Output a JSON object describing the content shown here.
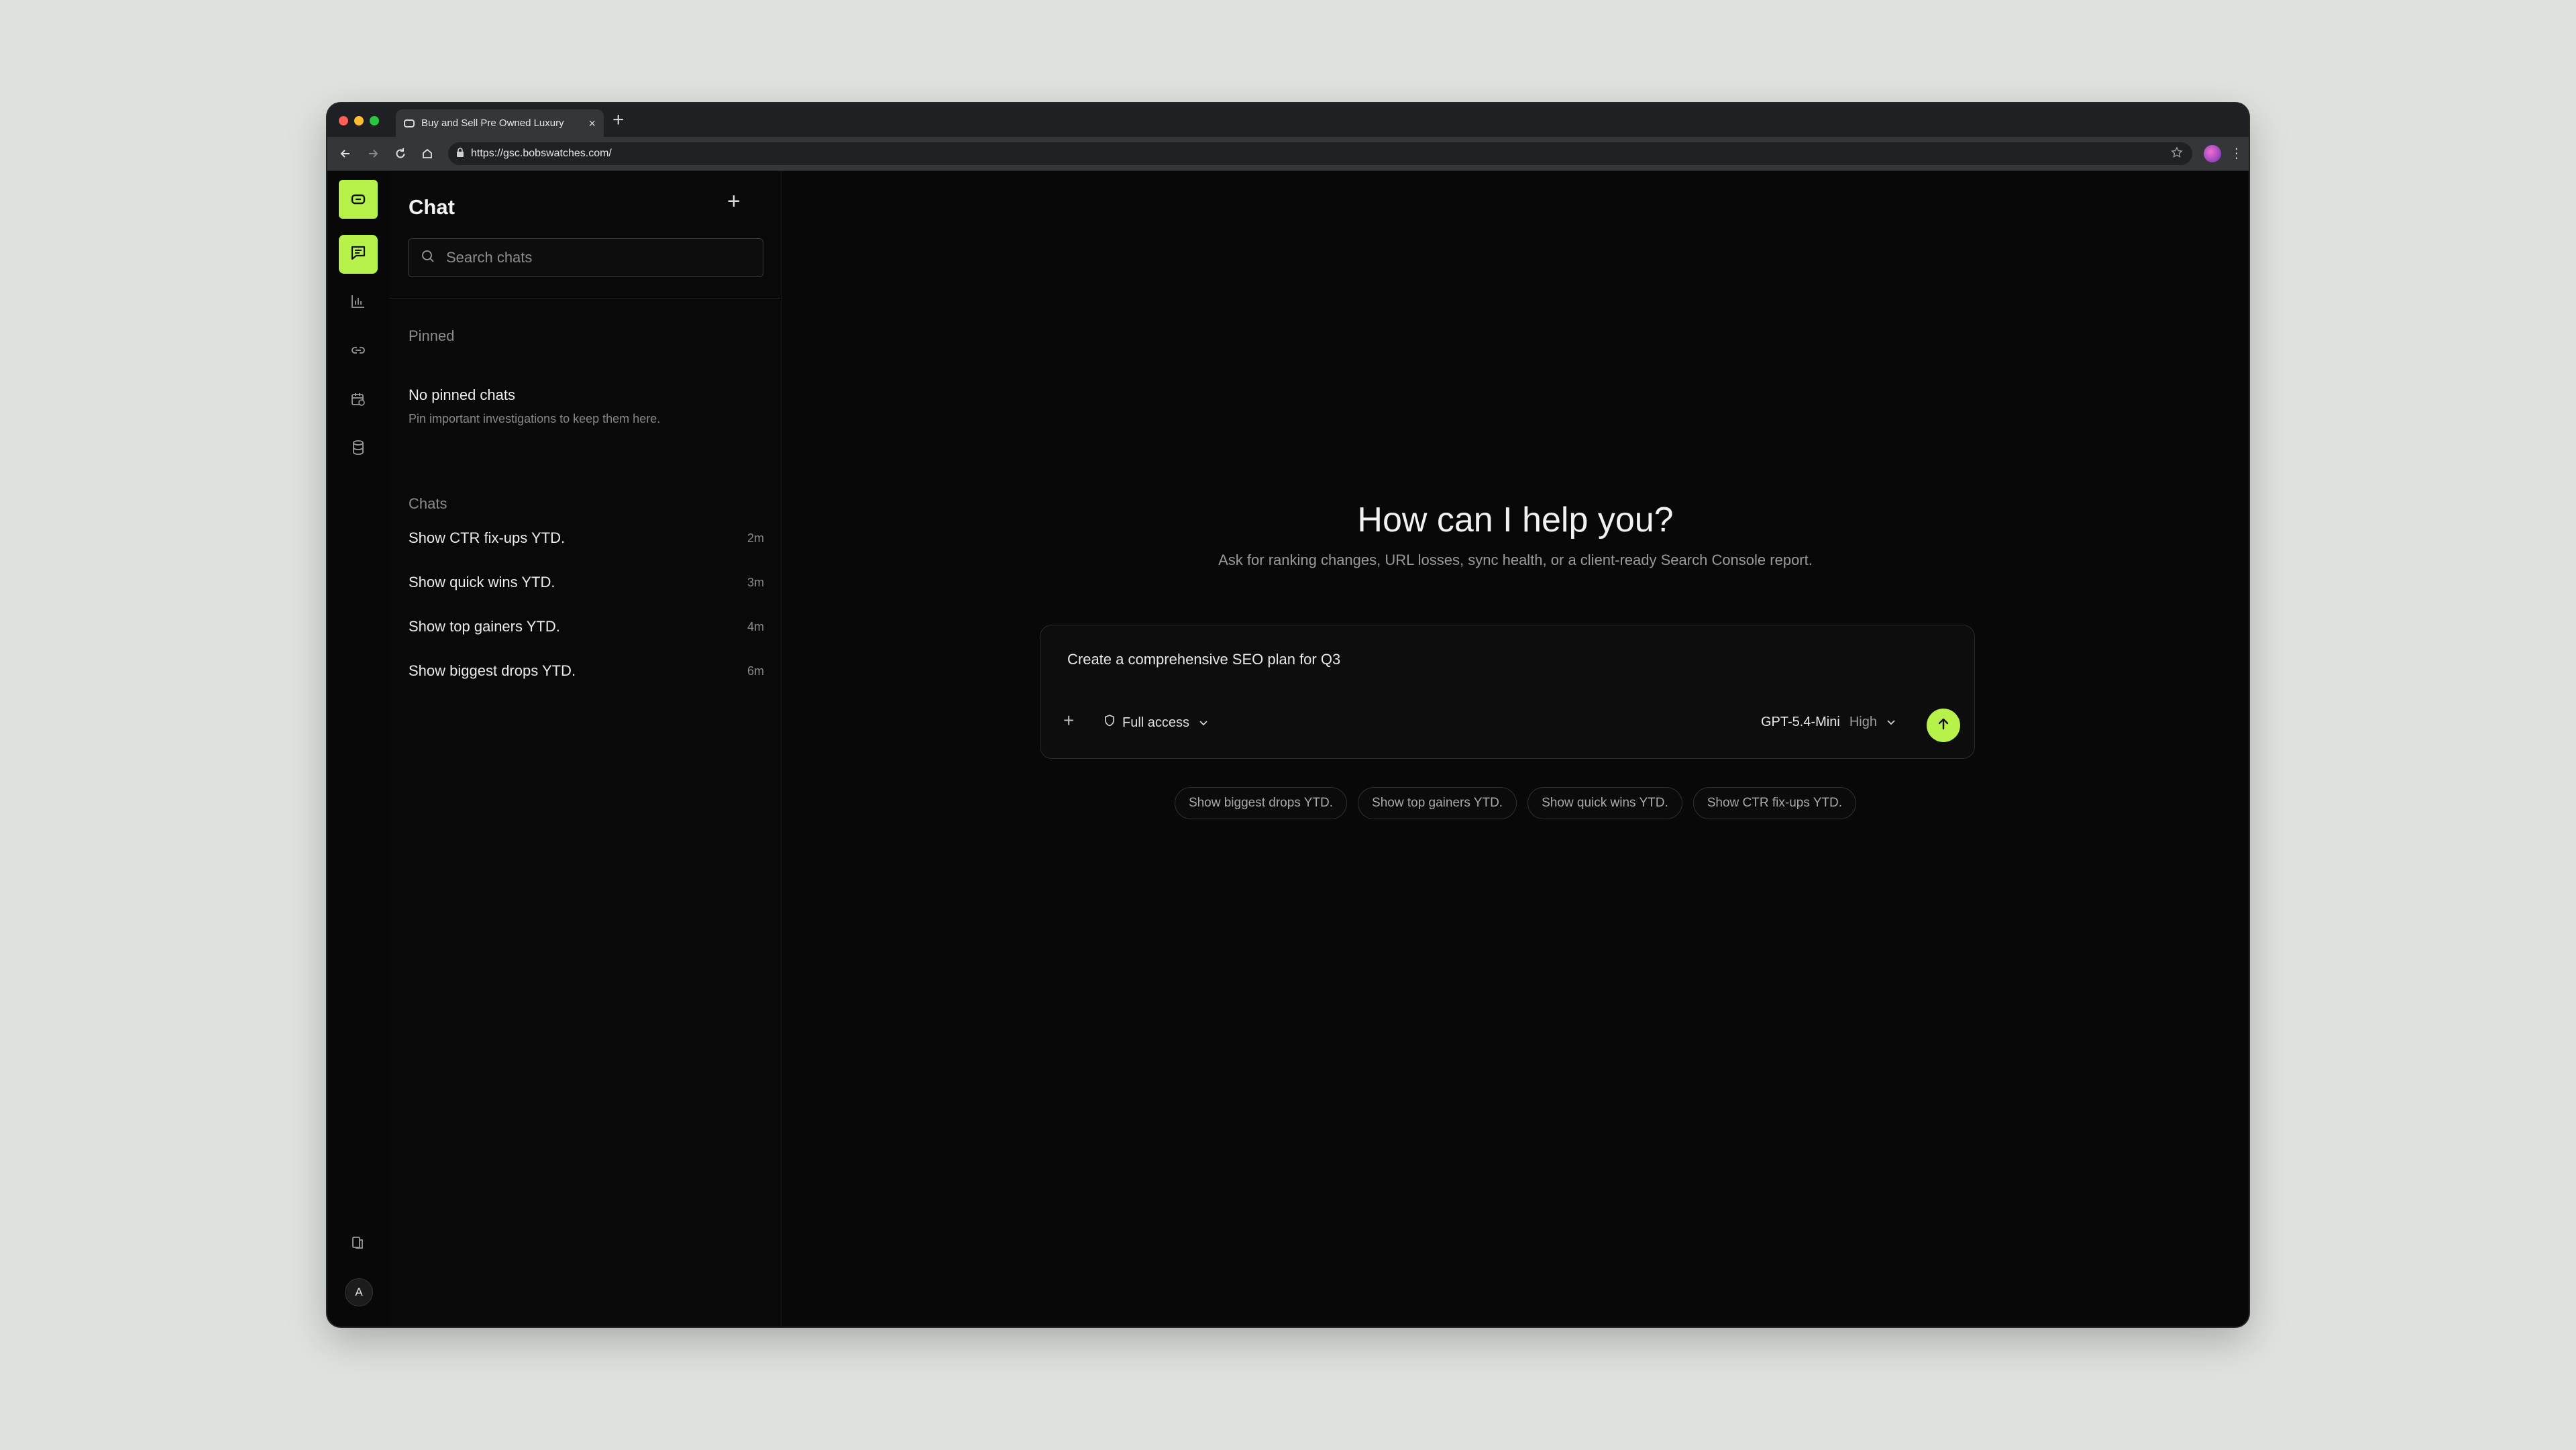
{
  "browser": {
    "tab_title": "Buy and Sell Pre Owned Luxury",
    "url": "https://gsc.bobswatches.com/"
  },
  "rail": {
    "items": [
      {
        "name": "chat-icon",
        "active": true
      },
      {
        "name": "chart-icon",
        "active": false
      },
      {
        "name": "link-icon",
        "active": false
      },
      {
        "name": "calendar-icon",
        "active": false
      },
      {
        "name": "database-icon",
        "active": false
      }
    ],
    "avatar_initial": "A"
  },
  "sidebar": {
    "title": "Chat",
    "search_placeholder": "Search chats",
    "pinned_label": "Pinned",
    "no_pinned_title": "No pinned chats",
    "no_pinned_sub": "Pin important investigations to keep them here.",
    "chats_label": "Chats",
    "chats": [
      {
        "label": "Show CTR fix-ups YTD.",
        "time": "2m"
      },
      {
        "label": "Show quick wins YTD.",
        "time": "3m"
      },
      {
        "label": "Show top gainers YTD.",
        "time": "4m"
      },
      {
        "label": "Show biggest drops YTD.",
        "time": "6m"
      }
    ]
  },
  "main": {
    "heading": "How can I help you?",
    "subheading": "Ask for ranking changes, URL losses, sync health, or a client-ready Search Console report.",
    "composer": {
      "value": "Create a comprehensive SEO plan for Q3",
      "access_label": "Full access",
      "model": "GPT-5.4-Mini",
      "effort": "High"
    },
    "suggestions": [
      "Show biggest drops YTD.",
      "Show top gainers YTD.",
      "Show quick wins YTD.",
      "Show CTR fix-ups YTD."
    ]
  },
  "colors": {
    "accent": "#b6f249",
    "background": "#080808",
    "desktop": "#dfe3df"
  }
}
